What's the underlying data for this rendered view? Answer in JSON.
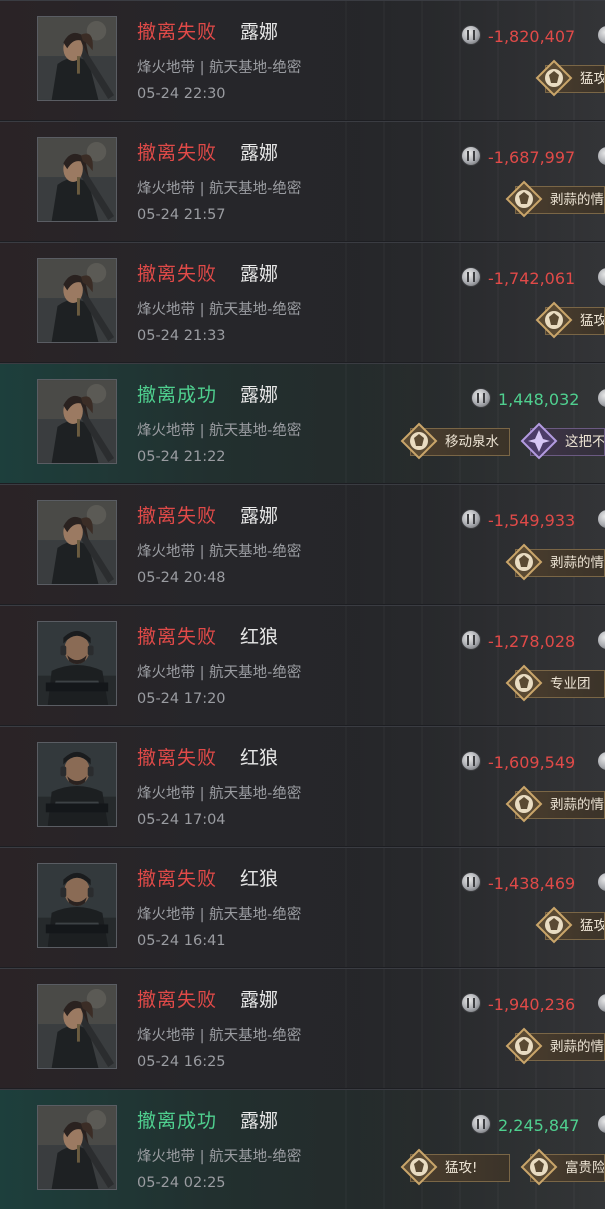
{
  "colors": {
    "fail": "#e04a48",
    "success": "#4fd08f",
    "badge_gold": "#c9a56a",
    "badge_purple": "#9b7fd0"
  },
  "rows": [
    {
      "status": "撤离失败",
      "result": "fail",
      "operator": "露娜",
      "location": "烽火地带 | 航天基地-绝密",
      "time": "05-24 22:30",
      "value": "-1,820,407",
      "badges": [
        {
          "label": "猛攻",
          "tier": "gold"
        }
      ]
    },
    {
      "status": "撤离失败",
      "result": "fail",
      "operator": "露娜",
      "location": "烽火地带 | 航天基地-绝密",
      "time": "05-24 21:57",
      "value": "-1,687,997",
      "badges": [
        {
          "label": "剥蒜的情",
          "tier": "gold"
        }
      ]
    },
    {
      "status": "撤离失败",
      "result": "fail",
      "operator": "露娜",
      "location": "烽火地带 | 航天基地-绝密",
      "time": "05-24 21:33",
      "value": "-1,742,061",
      "badges": [
        {
          "label": "猛攻",
          "tier": "gold"
        }
      ]
    },
    {
      "status": "撤离成功",
      "result": "success",
      "operator": "露娜",
      "location": "烽火地带 | 航天基地-绝密",
      "time": "05-24 21:22",
      "value": "1,448,032",
      "badges": [
        {
          "label": "移动泉水",
          "tier": "gold"
        },
        {
          "label": "这把不",
          "tier": "purple"
        }
      ]
    },
    {
      "status": "撤离失败",
      "result": "fail",
      "operator": "露娜",
      "location": "烽火地带 | 航天基地-绝密",
      "time": "05-24 20:48",
      "value": "-1,549,933",
      "badges": [
        {
          "label": "剥蒜的情",
          "tier": "gold"
        }
      ]
    },
    {
      "status": "撤离失败",
      "result": "fail",
      "operator": "红狼",
      "location": "烽火地带 | 航天基地-绝密",
      "time": "05-24 17:20",
      "value": "-1,278,028",
      "badges": [
        {
          "label": "专业团",
          "tier": "gold"
        }
      ]
    },
    {
      "status": "撤离失败",
      "result": "fail",
      "operator": "红狼",
      "location": "烽火地带 | 航天基地-绝密",
      "time": "05-24 17:04",
      "value": "-1,609,549",
      "badges": [
        {
          "label": "剥蒜的情",
          "tier": "gold"
        }
      ]
    },
    {
      "status": "撤离失败",
      "result": "fail",
      "operator": "红狼",
      "location": "烽火地带 | 航天基地-绝密",
      "time": "05-24 16:41",
      "value": "-1,438,469",
      "badges": [
        {
          "label": "猛攻",
          "tier": "gold"
        }
      ]
    },
    {
      "status": "撤离失败",
      "result": "fail",
      "operator": "露娜",
      "location": "烽火地带 | 航天基地-绝密",
      "time": "05-24 16:25",
      "value": "-1,940,236",
      "badges": [
        {
          "label": "剥蒜的情",
          "tier": "gold"
        }
      ]
    },
    {
      "status": "撤离成功",
      "result": "success",
      "operator": "露娜",
      "location": "烽火地带 | 航天基地-绝密",
      "time": "05-24 02:25",
      "value": "2,245,847",
      "badges": [
        {
          "label": "猛攻!",
          "tier": "gold"
        },
        {
          "label": "富贵险中",
          "tier": "gold"
        }
      ]
    }
  ]
}
